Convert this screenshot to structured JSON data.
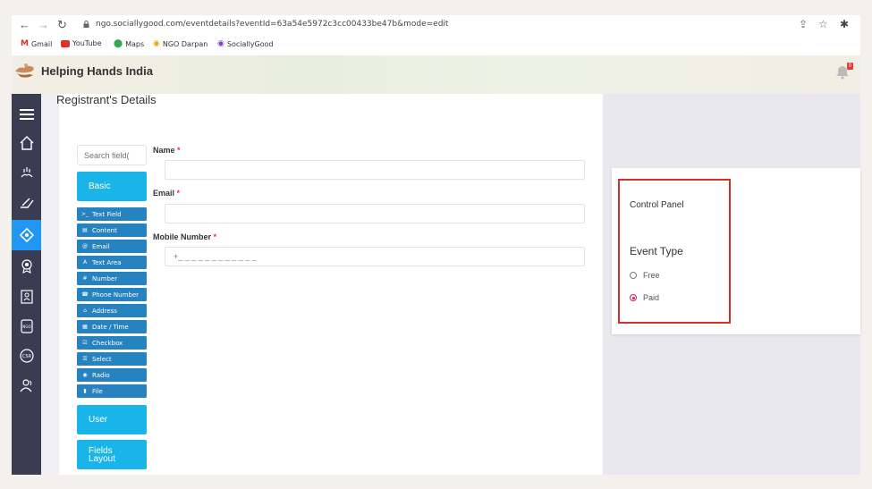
{
  "browser": {
    "url": "ngo.sociallygood.com/eventdetails?eventId=63a54e5972c3cc00433be47b&mode=edit",
    "bookmarks": [
      "Gmail",
      "YouTube",
      "Maps",
      "NGO Darpan",
      "SociallyGood"
    ]
  },
  "header": {
    "brand": "Helping Hands India",
    "notification_count": "0"
  },
  "main": {
    "title": "Registrant's Details",
    "search_placeholder": "Search field(",
    "basic_label": "Basic",
    "field_types": [
      {
        "label": "Text Field",
        "icon": ">_"
      },
      {
        "label": "Content",
        "icon": "▤"
      },
      {
        "label": "Email",
        "icon": "@"
      },
      {
        "label": "Text Area",
        "icon": "A"
      },
      {
        "label": "Number",
        "icon": "#"
      },
      {
        "label": "Phone Number",
        "icon": "☎"
      },
      {
        "label": "Address",
        "icon": "⌂"
      },
      {
        "label": "Date / Time",
        "icon": "▦"
      },
      {
        "label": "Checkbox",
        "icon": "☑"
      },
      {
        "label": "Select",
        "icon": "☰"
      },
      {
        "label": "Radio",
        "icon": "◉"
      },
      {
        "label": "File",
        "icon": "▮"
      }
    ],
    "user_label": "User",
    "fields_label": "Fields",
    "layout_label": "Layout"
  },
  "form": {
    "name_label": "Name",
    "email_label": "Email",
    "mobile_label": "Mobile Number",
    "mobile_placeholder": "+_ _ _ _ _ _ _ _ _ _ _ _",
    "required_mark": "*"
  },
  "control_panel": {
    "title": "Control Panel",
    "event_type_label": "Event Type",
    "options": [
      {
        "label": "Free",
        "selected": false
      },
      {
        "label": "Paid",
        "selected": true
      }
    ]
  },
  "colors": {
    "sidebar": "#3a3d52",
    "accent": "#1ab5e8",
    "field_button": "#2783bf",
    "required": "#e53935",
    "highlight": "#d32f2f"
  }
}
